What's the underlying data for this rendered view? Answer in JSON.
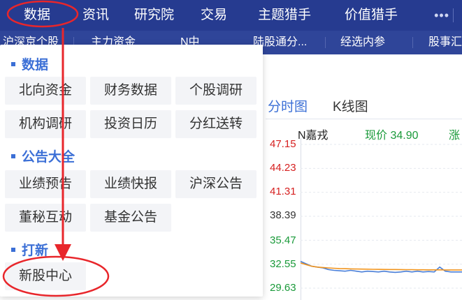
{
  "top_nav": {
    "items": [
      "数据",
      "资讯",
      "研究院",
      "交易",
      "主题猎手",
      "价值猎手"
    ],
    "more": "•••"
  },
  "sub_nav": {
    "items": [
      "沪深京个股",
      "主力资金",
      "N中",
      "陆股通分...",
      "经选内参",
      "股事汇"
    ]
  },
  "dropdown": {
    "sections": [
      {
        "title": "数据",
        "buttons": [
          "北向资金",
          "财务数据",
          "个股调研",
          "机构调研",
          "投资日历",
          "分红送转"
        ]
      },
      {
        "title": "公告大全",
        "buttons": [
          "业绩预告",
          "业绩快报",
          "沪深公告",
          "董秘互动",
          "基金公告"
        ]
      },
      {
        "title": "打新",
        "buttons": [
          "新股中心"
        ]
      }
    ]
  },
  "chart_panel": {
    "tabs": [
      "分时图",
      "K线图"
    ],
    "stock_name": "N嘉戎",
    "price_label": "现价 34.90",
    "change_label": "涨",
    "y_ticks": [
      "47.15",
      "44.23",
      "41.31",
      "38.39",
      "35.47",
      "32.55",
      "29.63"
    ],
    "colors": {
      "up": "#d62020",
      "down": "#1a9a3a",
      "price_line": "#4a7fd8",
      "avg_line": "#f0941e"
    }
  },
  "annotations": {
    "color": "#e8262b"
  },
  "chart_data": {
    "type": "line",
    "title": "",
    "xlabel": "",
    "ylabel": "",
    "ylim": [
      29.63,
      47.15
    ],
    "y_ticks": [
      47.15,
      44.23,
      41.31,
      38.39,
      35.47,
      32.55,
      29.63
    ],
    "series": [
      {
        "values": [
          32.9,
          32.6,
          32.3,
          32.2,
          32.1,
          31.9,
          31.8,
          31.75,
          31.7,
          31.8,
          31.7,
          31.6,
          31.7,
          31.65,
          31.6,
          31.7,
          31.6,
          31.55,
          31.6,
          31.7,
          31.6,
          31.7,
          31.6,
          31.65,
          31.6,
          32.2,
          31.7,
          31.6,
          31.6,
          31.6
        ]
      },
      {
        "values": [
          32.7,
          32.5,
          32.3,
          32.2,
          32.15,
          32.1,
          32.05,
          32.02,
          32.0,
          31.98,
          31.96,
          31.95,
          31.94,
          31.93,
          31.92,
          31.91,
          31.9,
          31.9,
          31.89,
          31.88,
          31.88,
          31.87,
          31.87,
          31.86,
          31.86,
          31.86,
          31.85,
          31.85,
          31.85,
          31.85
        ]
      }
    ]
  }
}
